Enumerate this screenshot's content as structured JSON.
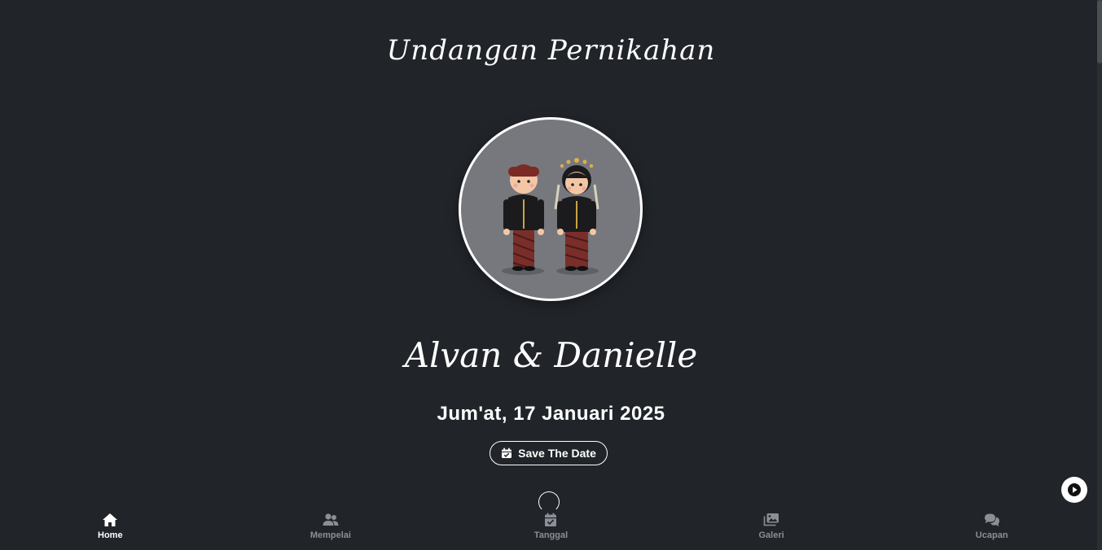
{
  "hero": {
    "title": "Undangan Pernikahan",
    "couple_names": "Alvan & Danielle",
    "date": "Jum'at, 17 Januari 2025",
    "save_date_label": "Save The Date"
  },
  "nav": {
    "items": [
      {
        "label": "Home",
        "icon": "home-icon",
        "active": true
      },
      {
        "label": "Mempelai",
        "icon": "users-icon",
        "active": false
      },
      {
        "label": "Tanggal",
        "icon": "calendar-check-icon",
        "active": false
      },
      {
        "label": "Galeri",
        "icon": "images-icon",
        "active": false
      },
      {
        "label": "Ucapan",
        "icon": "comments-icon",
        "active": false
      }
    ]
  },
  "music": {
    "icon": "play-icon"
  },
  "colors": {
    "background": "#212429",
    "text": "#ffffff",
    "nav_inactive": "#8b8f96",
    "photo_background": "#77787d"
  }
}
